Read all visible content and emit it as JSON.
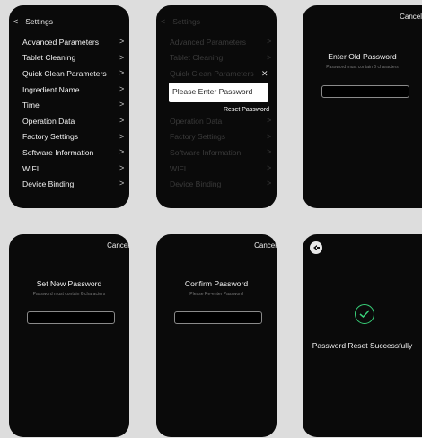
{
  "settings_title": "Settings",
  "menu_items": [
    "Advanced Parameters",
    "Tablet Cleaning",
    "Quick Clean Parameters",
    "Ingredient Name",
    "Time",
    "Operation Data",
    "Factory Settings",
    "Software Information",
    "WIFI",
    "Device Binding"
  ],
  "password_prompt": {
    "placeholder": "Please Enter Password",
    "reset_link": "Reset Password",
    "close_icon": "close-icon"
  },
  "old_password": {
    "cancel": "Cancel",
    "title": "Enter Old Password",
    "hint": "Password must contain 6 characters"
  },
  "new_password": {
    "cancel": "Cancel",
    "title": "Set New Password",
    "hint": "Password must contain 6 characters"
  },
  "confirm_password": {
    "cancel": "Cancel",
    "title": "Confirm Password",
    "hint": "Please Re-enter Password"
  },
  "success": {
    "message": "Password Reset Successfully",
    "icon": "check-circle-icon",
    "accent": "#39d27a"
  }
}
